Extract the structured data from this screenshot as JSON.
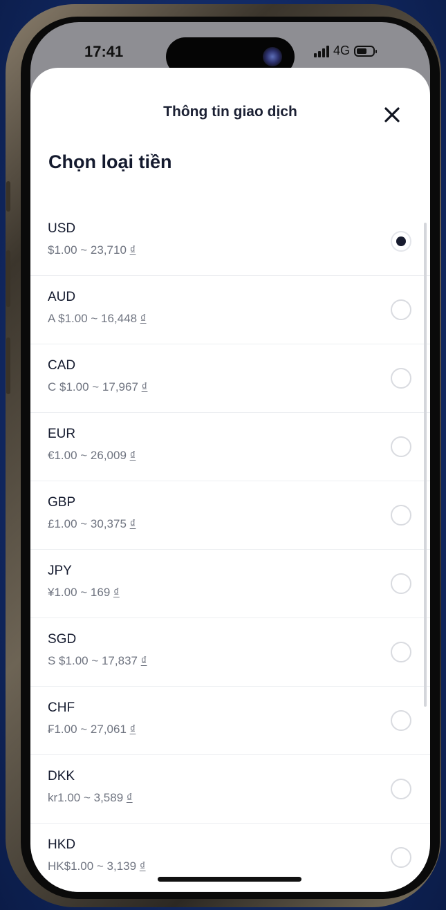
{
  "status_bar": {
    "time": "17:41",
    "network": "4G"
  },
  "header": {
    "title": "Thông tin giao dịch",
    "close_icon": "close-icon"
  },
  "section_title": "Chọn loại tiền",
  "currency_symbol": "₫",
  "selected_index": 0,
  "currencies": [
    {
      "code": "USD",
      "rate": "$1.00 ~ 23,710"
    },
    {
      "code": "AUD",
      "rate": "A $1.00 ~ 16,448"
    },
    {
      "code": "CAD",
      "rate": "C $1.00 ~ 17,967"
    },
    {
      "code": "EUR",
      "rate": "€1.00 ~ 26,009"
    },
    {
      "code": "GBP",
      "rate": "£1.00 ~ 30,375"
    },
    {
      "code": "JPY",
      "rate": "¥1.00 ~ 169"
    },
    {
      "code": "SGD",
      "rate": "S $1.00 ~ 17,837"
    },
    {
      "code": "CHF",
      "rate": "₣1.00 ~ 27,061"
    },
    {
      "code": "DKK",
      "rate": "kr1.00 ~ 3,589"
    },
    {
      "code": "HKD",
      "rate": "HK$1.00 ~ 3,139"
    }
  ],
  "colors": {
    "accent": "#171b2e",
    "background": "#142e6e"
  }
}
